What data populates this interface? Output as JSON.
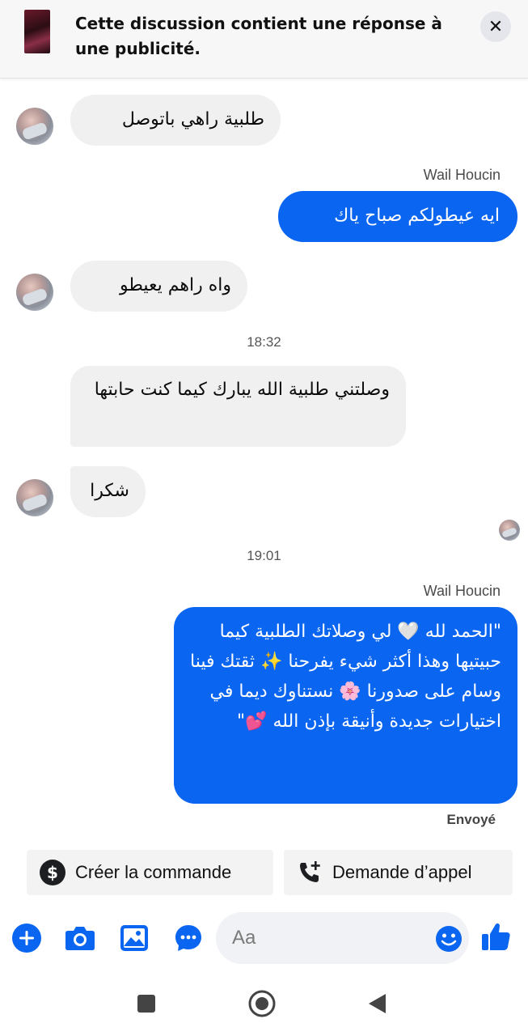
{
  "banner": {
    "text": "Cette discussion contient une réponse à une publicité.",
    "close_icon": "close-icon",
    "close_glyph": "✕"
  },
  "messages": [
    {
      "dir": "in",
      "text": "طلبية راهي باتوصل"
    },
    {
      "dir": "out",
      "sender": "Wail Houcin",
      "text": "ايه عيطولكم صباح ياك"
    },
    {
      "dir": "in",
      "text": "واه راهم يعيطو"
    },
    {
      "dir": "time",
      "text": "18:32"
    },
    {
      "dir": "in",
      "text": "وصلتني طلبية الله يبارك كيما كنت حابتها"
    },
    {
      "dir": "in",
      "text": "شكرا"
    },
    {
      "dir": "time",
      "text": "19:01"
    },
    {
      "dir": "out",
      "sender": "Wail Houcin",
      "text": "\"الحمد لله 🤍 لي وصلاتك الطلبية كيما حبيتيها وهذا أكثر شيء يفرحنا ✨ ثقتك فينا وسام على صدورنا 🌸 نستناوك ديما في اختيارات جديدة وأنيقة بإذن الله 💕\""
    }
  ],
  "status": "Envoyé",
  "quick_actions": [
    {
      "label": "Créer la commande",
      "icon": "dollar-icon"
    },
    {
      "label": "Demande d’appel",
      "icon": "phone-plus-icon"
    }
  ],
  "composer": {
    "placeholder": "Aa",
    "icons": [
      "plus-icon",
      "camera-icon",
      "image-icon",
      "chat-bubble-icon",
      "emoji-icon",
      "thumbs-up-icon"
    ]
  },
  "colors": {
    "accent": "#0a65f0",
    "incoming_bubble": "#f0f0f0",
    "banner_bg": "#f7f7f7"
  }
}
